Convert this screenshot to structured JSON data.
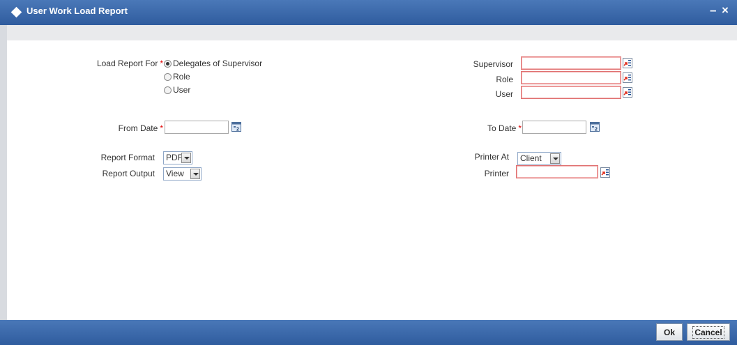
{
  "window": {
    "title": "User Work Load Report",
    "minimize_glyph": "–",
    "close_glyph": "×"
  },
  "form": {
    "load_report_for": {
      "label": "Load Report For",
      "required_mark": "*",
      "options": [
        {
          "label": "Delegates of Supervisor",
          "checked": true
        },
        {
          "label": "Role",
          "checked": false
        },
        {
          "label": "User",
          "checked": false
        }
      ]
    },
    "supervisor": {
      "label": "Supervisor",
      "value": ""
    },
    "role": {
      "label": "Role",
      "value": ""
    },
    "user": {
      "label": "User",
      "value": ""
    },
    "from_date": {
      "label": "From Date",
      "required_mark": "*",
      "value": ""
    },
    "to_date": {
      "label": "To Date",
      "required_mark": "*",
      "value": ""
    },
    "report_format": {
      "label": "Report Format",
      "value": "PDF"
    },
    "report_output": {
      "label": "Report Output",
      "value": "View"
    },
    "printer_at": {
      "label": "Printer At",
      "value": "Client"
    },
    "printer": {
      "label": "Printer",
      "value": ""
    }
  },
  "footer": {
    "ok_label": "Ok",
    "cancel_label": "Cancel"
  },
  "colors": {
    "titlebar": "#2f5c9e",
    "required": "#e00000",
    "mandatory_border": "#e07070"
  },
  "icons": {
    "lov": "list-of-values-icon",
    "calendar": "calendar-icon"
  }
}
